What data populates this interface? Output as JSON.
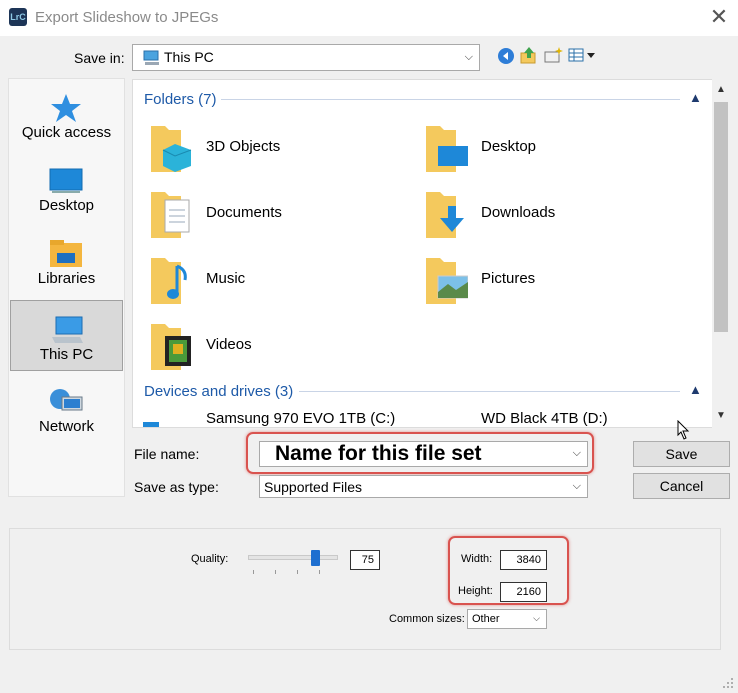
{
  "window": {
    "app_icon_text": "LrC",
    "title": "Export Slideshow to JPEGs",
    "close_glyph": "✕"
  },
  "save_in": {
    "label": "Save in:",
    "value": "This PC"
  },
  "places": [
    {
      "label": "Quick access",
      "icon": "quick-access-star-icon"
    },
    {
      "label": "Desktop",
      "icon": "desktop-icon"
    },
    {
      "label": "Libraries",
      "icon": "libraries-icon"
    },
    {
      "label": "This PC",
      "icon": "this-pc-icon",
      "selected": true
    },
    {
      "label": "Network",
      "icon": "network-icon"
    }
  ],
  "file_list": {
    "folders_header": "Folders (7)",
    "folders": [
      "3D Objects",
      "Desktop",
      "Documents",
      "Downloads",
      "Music",
      "Pictures",
      "Videos"
    ],
    "devices_header": "Devices and drives (3)",
    "drives": [
      "Samsung 970 EVO 1TB (C:)",
      "WD Black 4TB (D:)"
    ]
  },
  "file_name": {
    "label": "File name:",
    "value": "Name for this file set"
  },
  "save_as_type": {
    "label": "Save as type:",
    "value": "Supported Files"
  },
  "buttons": {
    "save": "Save",
    "cancel": "Cancel"
  },
  "options": {
    "quality_label": "Quality:",
    "quality_value": "75",
    "quality_fraction": 0.75,
    "width_label": "Width:",
    "width_value": "3840",
    "height_label": "Height:",
    "height_value": "2160",
    "common_sizes_label": "Common sizes:",
    "common_sizes_value": "Other"
  },
  "colors": {
    "accent_blue": "#1e5aa8",
    "highlight_red": "#d9534f",
    "folder_yellow": "#f4c95d"
  }
}
